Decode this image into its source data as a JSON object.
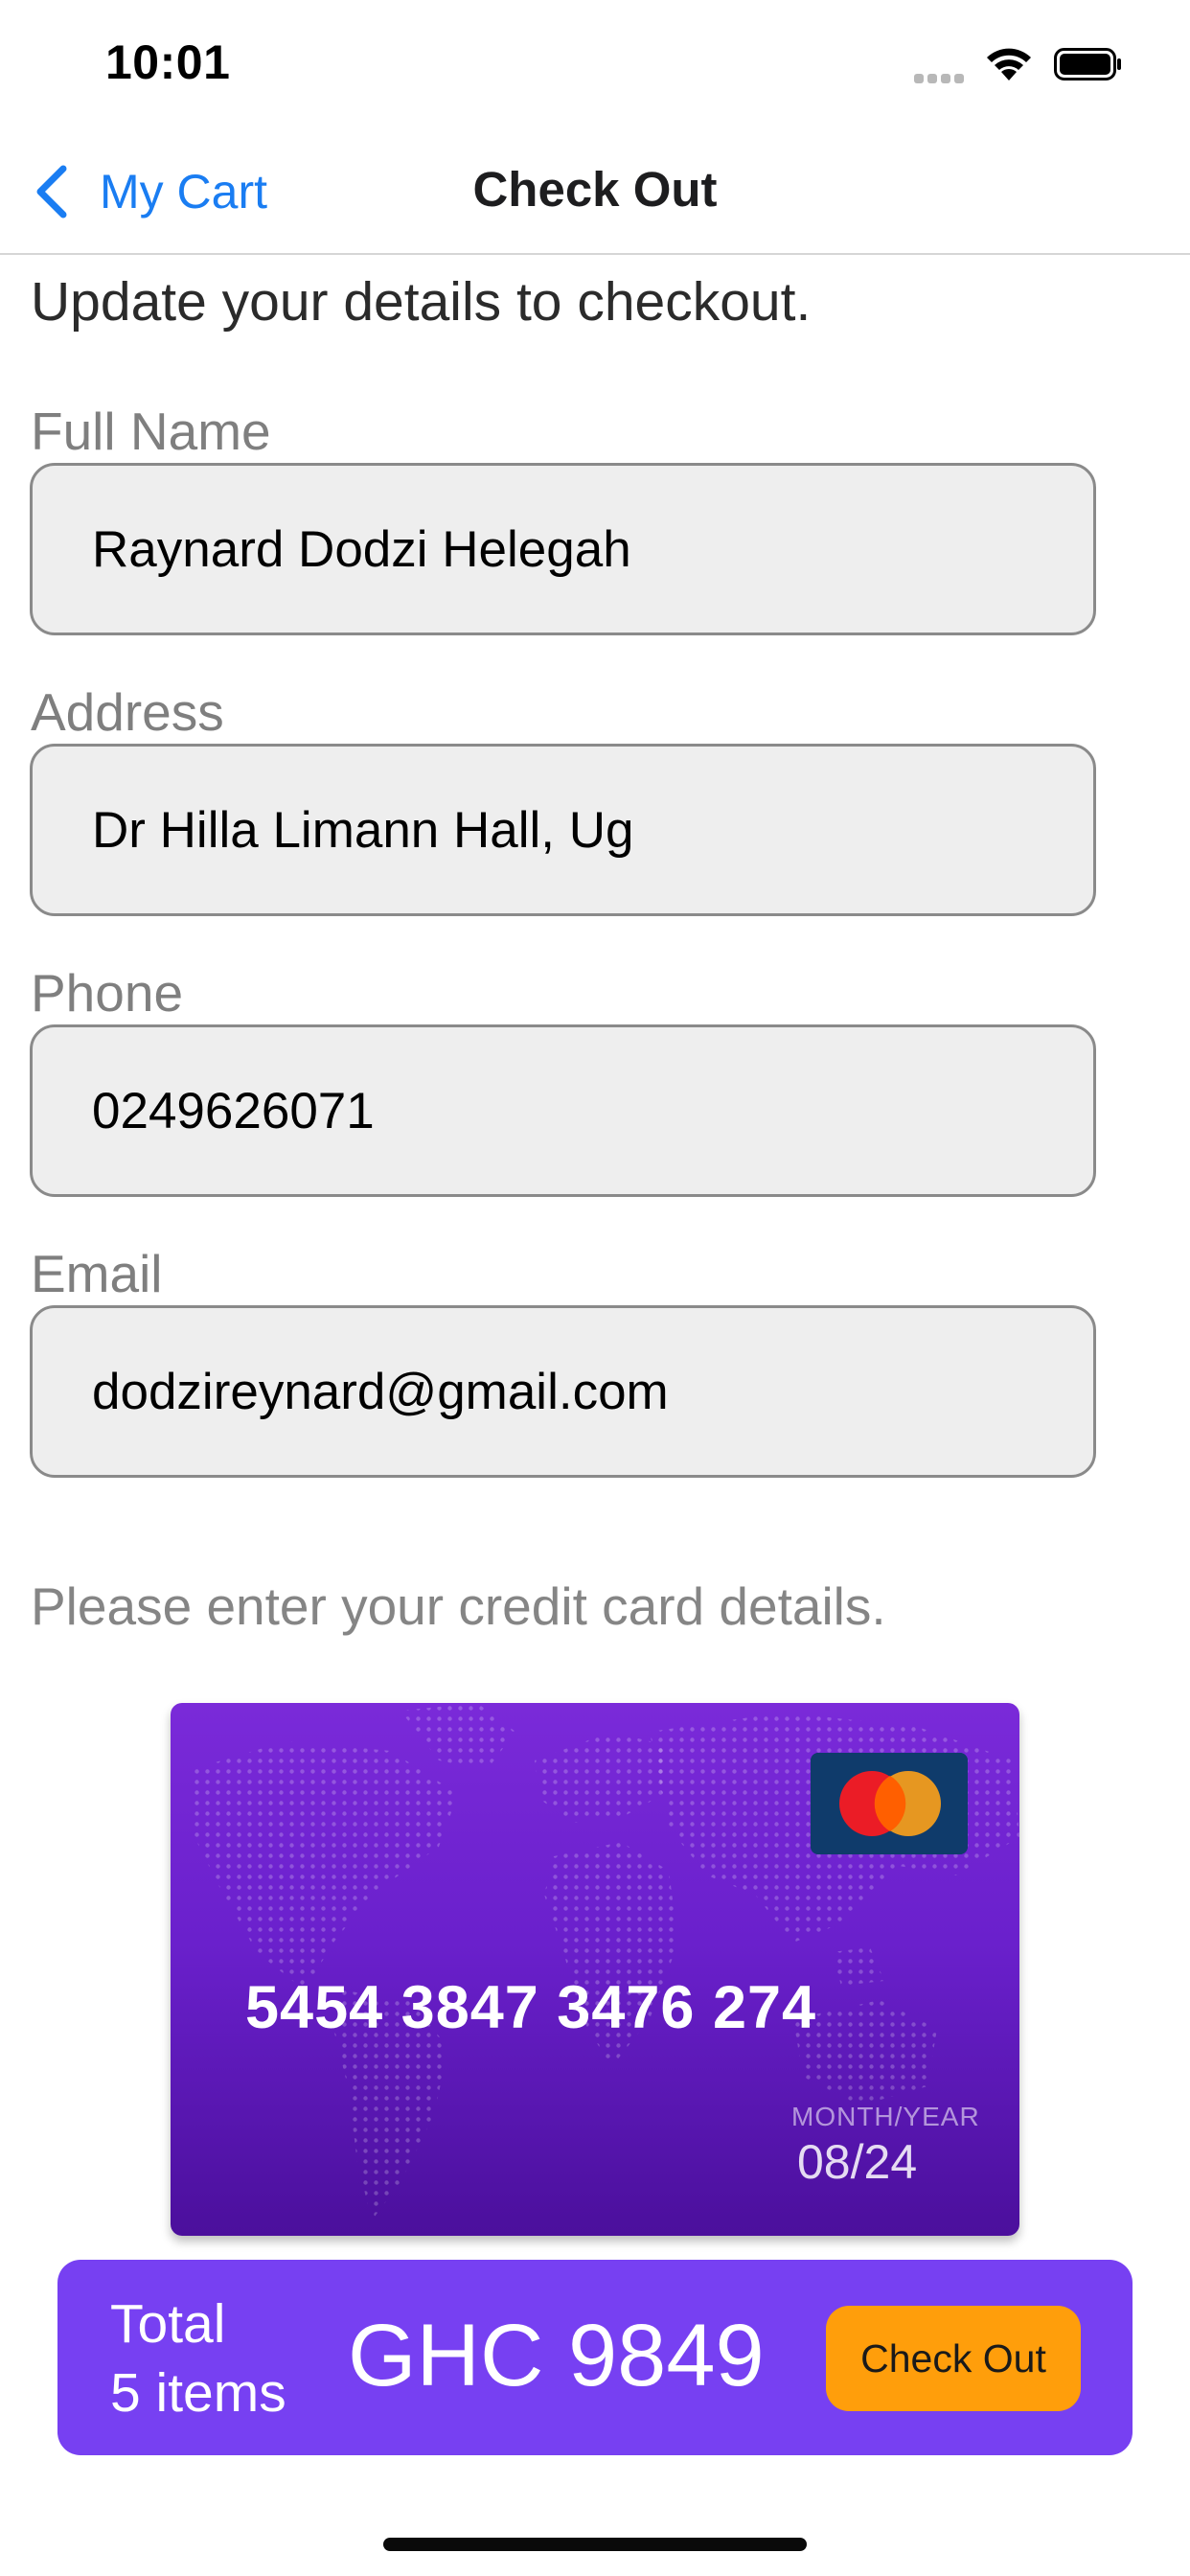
{
  "status_bar": {
    "time": "10:01"
  },
  "nav": {
    "back_label": "My Cart",
    "title": "Check Out"
  },
  "form": {
    "intro": "Update your details to checkout.",
    "fields": [
      {
        "label": "Full Name",
        "value": "Raynard Dodzi Helegah"
      },
      {
        "label": "Address",
        "value": "Dr Hilla Limann Hall, Ug"
      },
      {
        "label": "Phone",
        "value": "0249626071"
      },
      {
        "label": "Email",
        "value": "dodzireynard@gmail.com"
      }
    ]
  },
  "card": {
    "prompt": "Please enter your credit card details.",
    "number": "5454 3847 3476 274",
    "expiry_label": "MONTH/YEAR",
    "expiry": "08/24",
    "brand_icon": "mastercard-icon"
  },
  "checkout": {
    "total_label": "Total",
    "items": "5 items",
    "amount": "GHC 9849",
    "button_label": "Check Out"
  },
  "colors": {
    "accent_blue": "#1a7df2",
    "checkout_bar": "#7740f2",
    "checkout_button": "#ff9e0b",
    "card_top": "#7a2ad9",
    "card_bottom": "#4b0f9c"
  }
}
